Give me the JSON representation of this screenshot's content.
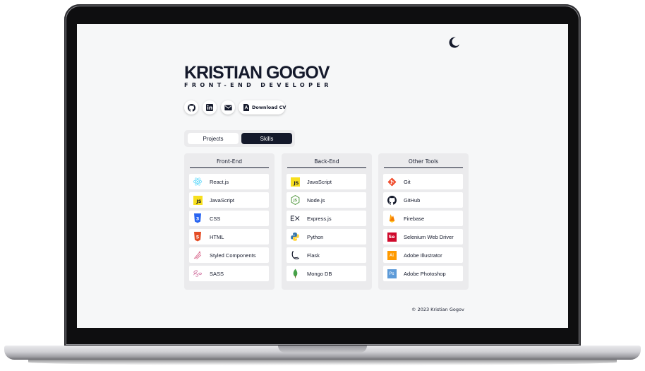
{
  "profile": {
    "name": "KRISTIAN GOGOV",
    "role": "FRONT-END DEVELOPER"
  },
  "social": {
    "github_icon": "github-icon",
    "linkedin_icon": "linkedin-icon",
    "email_icon": "mail-icon",
    "cv_label": "Download CV",
    "cv_icon": "pdf-icon"
  },
  "theme_toggle_icon": "moon-icon",
  "tabs": [
    {
      "label": "Projects",
      "active": false
    },
    {
      "label": "Skills",
      "active": true
    }
  ],
  "columns": [
    {
      "title": "Front-End",
      "skills": [
        {
          "label": "React.js",
          "icon": "react-icon"
        },
        {
          "label": "JavaScript",
          "icon": "javascript-icon"
        },
        {
          "label": "CSS",
          "icon": "css3-icon"
        },
        {
          "label": "HTML",
          "icon": "html5-icon"
        },
        {
          "label": "Styled Components",
          "icon": "styled-components-icon"
        },
        {
          "label": "SASS",
          "icon": "sass-icon"
        }
      ]
    },
    {
      "title": "Back-End",
      "skills": [
        {
          "label": "JavaScript",
          "icon": "javascript-icon"
        },
        {
          "label": "Node.js",
          "icon": "nodejs-icon"
        },
        {
          "label": "Express.js",
          "icon": "express-icon"
        },
        {
          "label": "Python",
          "icon": "python-icon"
        },
        {
          "label": "Flask",
          "icon": "flask-icon"
        },
        {
          "label": "Mongo DB",
          "icon": "mongodb-icon"
        }
      ]
    },
    {
      "title": "Other Tools",
      "skills": [
        {
          "label": "Git",
          "icon": "git-icon"
        },
        {
          "label": "GitHub",
          "icon": "github-icon"
        },
        {
          "label": "Firebase",
          "icon": "firebase-icon"
        },
        {
          "label": "Selenium Web Driver",
          "icon": "selenium-icon"
        },
        {
          "label": "Adobe Illustrator",
          "icon": "illustrator-icon"
        },
        {
          "label": "Adobe Photoshop",
          "icon": "photoshop-icon"
        }
      ]
    }
  ],
  "footer": "© 2023 Kristian Gogov",
  "colors": {
    "navy": "#14192b",
    "background": "#f6f7f8",
    "card": "#ebebed"
  }
}
